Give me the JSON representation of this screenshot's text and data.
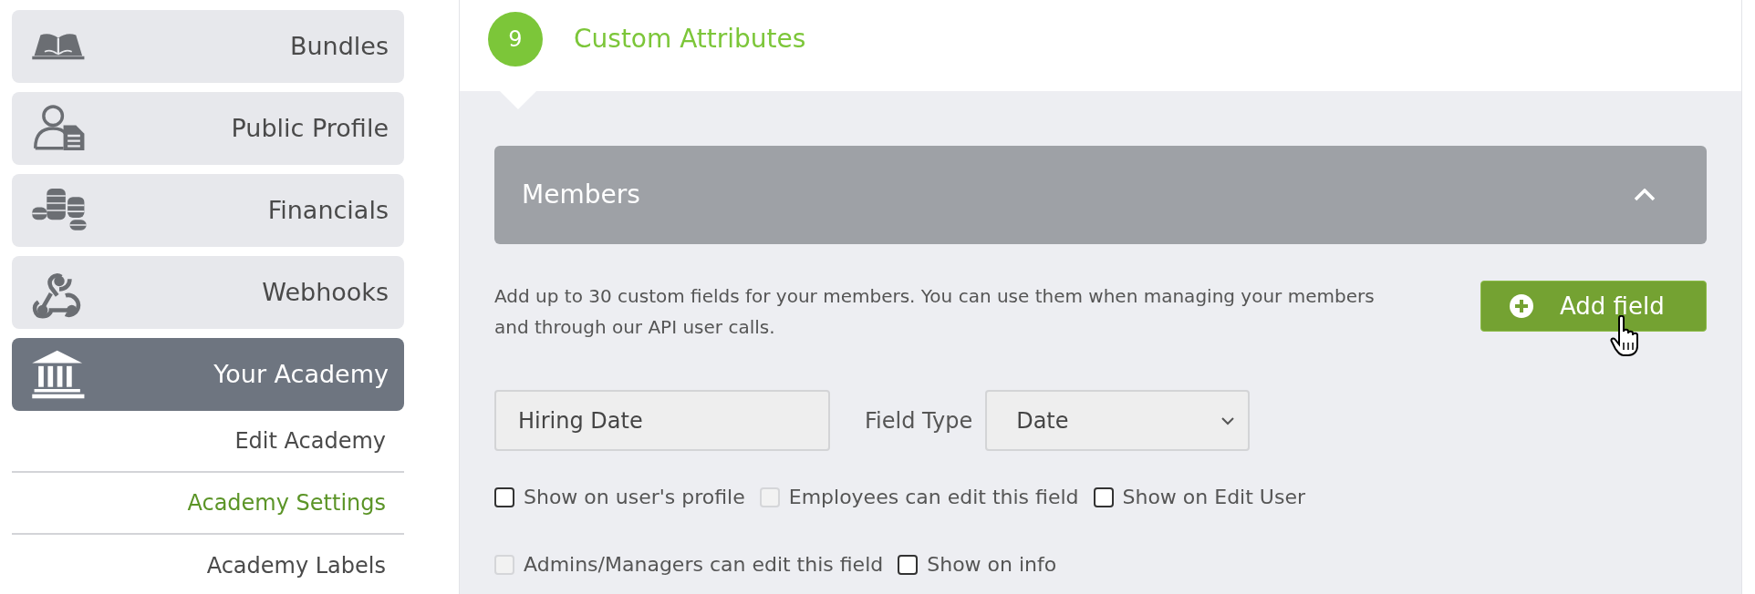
{
  "sidebar": {
    "items": [
      {
        "label": "Bundles",
        "kind": "book",
        "selected": false
      },
      {
        "label": "Public Profile",
        "kind": "profile",
        "selected": false
      },
      {
        "label": "Financials",
        "kind": "coins",
        "selected": false
      },
      {
        "label": "Webhooks",
        "kind": "webhook",
        "selected": false
      },
      {
        "label": "Your Academy",
        "kind": "building",
        "selected": true
      }
    ],
    "subitems": [
      {
        "label": "Edit Academy",
        "selected": false
      },
      {
        "label": "Academy Settings",
        "selected": true
      },
      {
        "label": "Academy Labels",
        "selected": false
      }
    ]
  },
  "section": {
    "step": "9",
    "title": "Custom Attributes"
  },
  "panel": {
    "title": "Members",
    "expanded": true
  },
  "description": "Add up to 30 custom fields for your members. You can use them when managing your members and through our API user calls.",
  "add_button": "Add field",
  "field": {
    "name": "Hiring Date",
    "type_label": "Field Type",
    "type": "Date"
  },
  "options": [
    {
      "label": "Show on user's profile",
      "checked": false,
      "disabled": false
    },
    {
      "label": "Employees can edit this field",
      "checked": false,
      "disabled": true
    },
    {
      "label": "Show on Edit User",
      "checked": false,
      "disabled": false
    },
    {
      "label": "Admins/Managers can edit this field",
      "checked": false,
      "disabled": true
    },
    {
      "label": "Show on info",
      "checked": false,
      "disabled": false
    }
  ]
}
